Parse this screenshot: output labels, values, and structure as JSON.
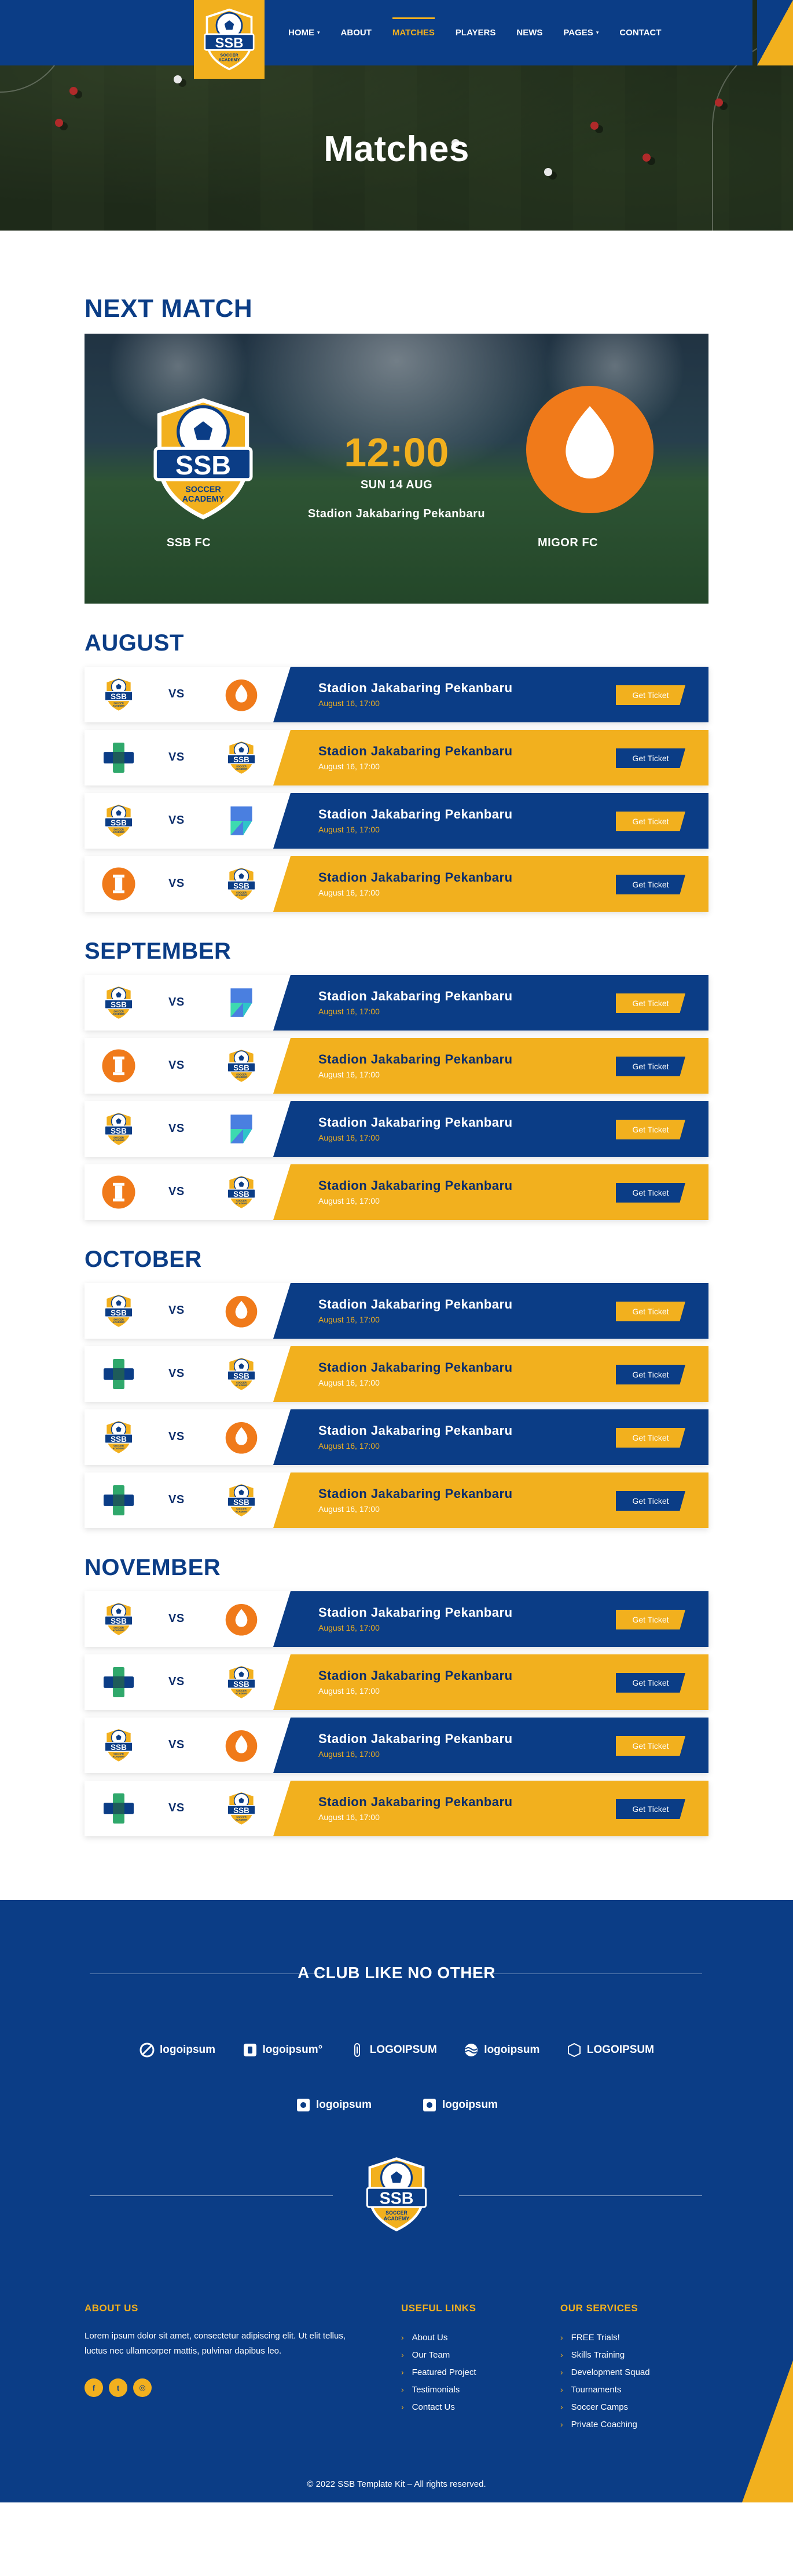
{
  "nav": {
    "logo_text": "SSB",
    "logo_sub": "SOCCER ACADEMY",
    "items": [
      {
        "label": "HOME",
        "dropdown": true,
        "active": false
      },
      {
        "label": "ABOUT",
        "dropdown": false,
        "active": false
      },
      {
        "label": "MATCHES",
        "dropdown": false,
        "active": true
      },
      {
        "label": "PLAYERS",
        "dropdown": false,
        "active": false
      },
      {
        "label": "NEWS",
        "dropdown": false,
        "active": false
      },
      {
        "label": "PAGES",
        "dropdown": true,
        "active": false
      },
      {
        "label": "CONTACT",
        "dropdown": false,
        "active": false
      }
    ],
    "caret": "▾"
  },
  "hero": {
    "title": "Matches"
  },
  "next_match": {
    "heading": "NEXT MATCH",
    "home_team": "SSB FC",
    "away_team": "MIGOR FC",
    "time": "12:00",
    "date": "SUN 14 AUG",
    "venue": "Stadion Jakabaring Pekanbaru"
  },
  "vs_label": "VS",
  "ticket_label": "Get Ticket",
  "months": [
    {
      "name": "AUGUST",
      "matches": [
        {
          "team_a": "ssb",
          "team_b": "orange",
          "band": "blue",
          "venue": "Stadion Jakabaring Pekanbaru",
          "date": "August 16, 17:00"
        },
        {
          "team_a": "cross",
          "team_b": "ssb",
          "band": "yellow",
          "venue": "Stadion Jakabaring Pekanbaru",
          "date": "August 16, 17:00"
        },
        {
          "team_a": "ssb",
          "team_b": "lgreen",
          "band": "blue",
          "venue": "Stadion Jakabaring Pekanbaru",
          "date": "August 16, 17:00"
        },
        {
          "team_a": "pillar",
          "team_b": "ssb",
          "band": "yellow",
          "venue": "Stadion Jakabaring Pekanbaru",
          "date": "August 16, 17:00"
        }
      ]
    },
    {
      "name": "SEPTEMBER",
      "matches": [
        {
          "team_a": "ssb",
          "team_b": "lgreen",
          "band": "blue",
          "venue": "Stadion Jakabaring Pekanbaru",
          "date": "August 16, 17:00"
        },
        {
          "team_a": "pillar",
          "team_b": "ssb",
          "band": "yellow",
          "venue": "Stadion Jakabaring Pekanbaru",
          "date": "August 16, 17:00"
        },
        {
          "team_a": "ssb",
          "team_b": "lgreen",
          "band": "blue",
          "venue": "Stadion Jakabaring Pekanbaru",
          "date": "August 16, 17:00"
        },
        {
          "team_a": "pillar",
          "team_b": "ssb",
          "band": "yellow",
          "venue": "Stadion Jakabaring Pekanbaru",
          "date": "August 16, 17:00"
        }
      ]
    },
    {
      "name": "OCTOBER",
      "matches": [
        {
          "team_a": "ssb",
          "team_b": "orange",
          "band": "blue",
          "venue": "Stadion Jakabaring Pekanbaru",
          "date": "August 16, 17:00"
        },
        {
          "team_a": "cross",
          "team_b": "ssb",
          "band": "yellow",
          "venue": "Stadion Jakabaring Pekanbaru",
          "date": "August 16, 17:00"
        },
        {
          "team_a": "ssb",
          "team_b": "orange",
          "band": "blue",
          "venue": "Stadion Jakabaring Pekanbaru",
          "date": "August 16, 17:00"
        },
        {
          "team_a": "cross",
          "team_b": "ssb",
          "band": "yellow",
          "venue": "Stadion Jakabaring Pekanbaru",
          "date": "August 16, 17:00"
        }
      ]
    },
    {
      "name": "NOVEMBER",
      "matches": [
        {
          "team_a": "ssb",
          "team_b": "orange",
          "band": "blue",
          "venue": "Stadion Jakabaring Pekanbaru",
          "date": "August 16, 17:00"
        },
        {
          "team_a": "cross",
          "team_b": "ssb",
          "band": "yellow",
          "venue": "Stadion Jakabaring Pekanbaru",
          "date": "August 16, 17:00"
        },
        {
          "team_a": "ssb",
          "team_b": "orange",
          "band": "blue",
          "venue": "Stadion Jakabaring Pekanbaru",
          "date": "August 16, 17:00"
        },
        {
          "team_a": "cross",
          "team_b": "ssb",
          "band": "yellow",
          "venue": "Stadion Jakabaring Pekanbaru",
          "date": "August 16, 17:00"
        }
      ]
    }
  ],
  "footer": {
    "club_title": "A CLUB LIKE NO OTHER",
    "partners_row1": [
      {
        "icon": "circle-slash-icon",
        "text": "logoipsum"
      },
      {
        "icon": "square-b-icon",
        "text": "logoipsum°"
      },
      {
        "icon": "bulb-icon",
        "text": "LOGOIPSUM"
      },
      {
        "icon": "waves-icon",
        "text": "logoipsum"
      },
      {
        "icon": "chevron-icon",
        "text": "LOGOIPSUM"
      }
    ],
    "partners_row2": [
      {
        "icon": "tag-icon",
        "text": "logoipsum"
      },
      {
        "icon": "tag-icon",
        "text": "logoipsum"
      }
    ],
    "about": {
      "title": "ABOUT US",
      "text": "Lorem ipsum dolor sit amet, consectetur adipiscing elit. Ut elit tellus, luctus nec ullamcorper mattis, pulvinar dapibus leo.",
      "socials": [
        {
          "icon": "facebook-icon",
          "glyph": "f"
        },
        {
          "icon": "twitter-icon",
          "glyph": "t"
        },
        {
          "icon": "instagram-icon",
          "glyph": "◎"
        }
      ]
    },
    "useful_links": {
      "title": "USEFUL LINKS",
      "items": [
        "About Us",
        "Our Team",
        "Featured Project",
        "Testimonials",
        "Contact Us"
      ]
    },
    "services": {
      "title": "OUR SERVICES",
      "items": [
        "FREE Trials!",
        "Skills Training",
        "Development Squad",
        "Tournaments",
        "Soccer Camps",
        "Private Coaching"
      ]
    },
    "chevron": "›",
    "copyright": "© 2022 SSB Template Kit – All rights reserved."
  },
  "colors": {
    "primary_blue": "#0b3d86",
    "accent_yellow": "#f2b01e",
    "orange": "#f07a1a",
    "green": "#2fa86b"
  }
}
